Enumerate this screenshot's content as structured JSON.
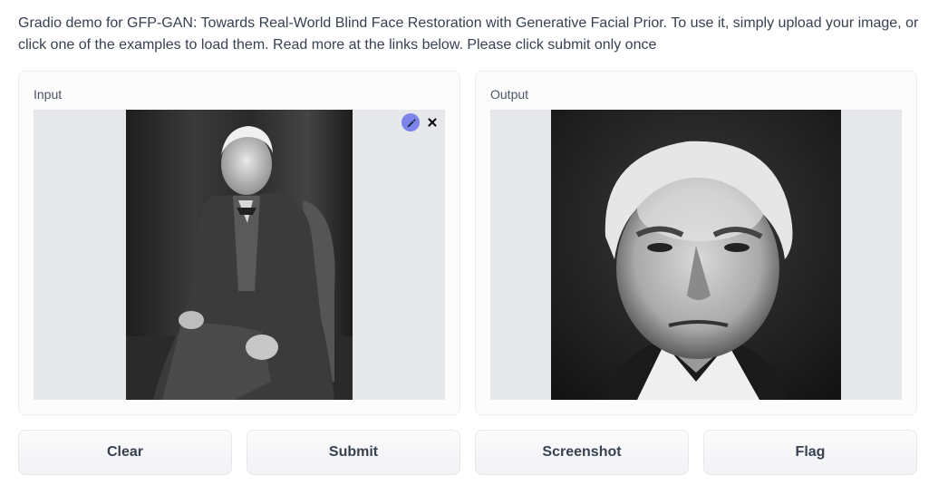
{
  "description": "Gradio demo for GFP-GAN: Towards Real-World Blind Face Restoration with Generative Facial Prior. To use it, simply upload your image, or click one of the examples to load them. Read more at the links below. Please click submit only once",
  "input_panel": {
    "label": "Input",
    "edit_icon": "pencil-icon",
    "remove_icon": "close-icon"
  },
  "output_panel": {
    "label": "Output"
  },
  "buttons": {
    "clear": "Clear",
    "submit": "Submit",
    "screenshot": "Screenshot",
    "flag": "Flag"
  },
  "colors": {
    "edit_button": "#7c83ea",
    "image_placeholder_bg": "#e5e7eb"
  }
}
